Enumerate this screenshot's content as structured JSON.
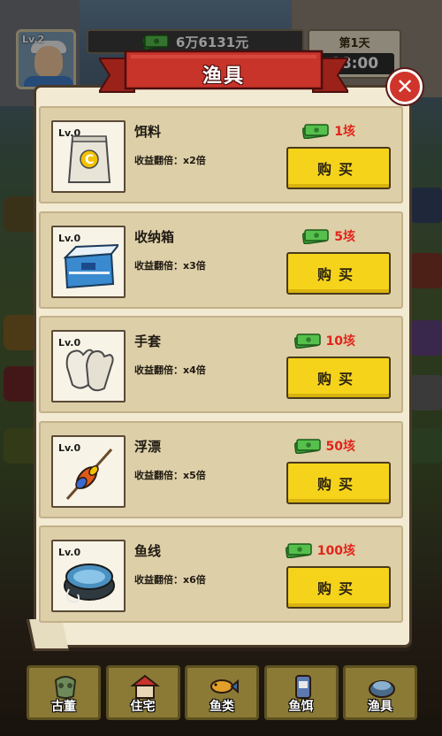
{
  "hud": {
    "level": "Lv.2",
    "money": "6万6131元",
    "day": "第1天",
    "time": "08:00"
  },
  "panel": {
    "title": "渔具",
    "close_icon": "close-icon"
  },
  "buy_label": "购买",
  "items": [
    {
      "name": "饵料",
      "level": "Lv.0",
      "bonus": "收益翻倍：x2倍",
      "price": "1垓",
      "icon": "bait-bag-icon"
    },
    {
      "name": "收纳箱",
      "level": "Lv.0",
      "bonus": "收益翻倍：x3倍",
      "price": "5垓",
      "icon": "tackle-box-icon"
    },
    {
      "name": "手套",
      "level": "Lv.0",
      "bonus": "收益翻倍：x4倍",
      "price": "10垓",
      "icon": "gloves-icon"
    },
    {
      "name": "浮漂",
      "level": "Lv.0",
      "bonus": "收益翻倍：x5倍",
      "price": "50垓",
      "icon": "float-bobber-icon"
    },
    {
      "name": "鱼线",
      "level": "Lv.0",
      "bonus": "收益翻倍：x6倍",
      "price": "100垓",
      "icon": "fishing-line-icon"
    }
  ],
  "bottom_nav": [
    {
      "label": "古董",
      "icon": "antique-icon"
    },
    {
      "label": "住宅",
      "icon": "house-icon"
    },
    {
      "label": "鱼类",
      "icon": "fish-icon"
    },
    {
      "label": "鱼饵",
      "icon": "bait-icon"
    },
    {
      "label": "渔具",
      "icon": "gear-icon"
    }
  ],
  "colors": {
    "price_red": "#e2231a",
    "buy_yellow": "#f6d31b",
    "ribbon_red": "#c8332a",
    "panel_bg": "#f2ead2",
    "row_bg": "#ddcfa8"
  }
}
